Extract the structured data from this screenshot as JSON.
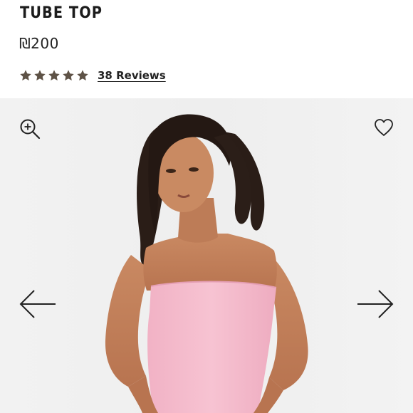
{
  "product": {
    "title": "TUBE TOP",
    "price": "₪200",
    "rating": 5,
    "rating_max": 5,
    "reviews_label": "38 Reviews"
  },
  "gallery": {
    "image_description": "Model with long dark hair wearing a pink strapless tube top against a light grey background",
    "icons": {
      "zoom": "zoom-in-icon",
      "wishlist": "heart-icon",
      "prev": "arrow-left-icon",
      "next": "arrow-right-icon"
    }
  },
  "colors": {
    "star": "#5e5246",
    "text": "#1c1c1c",
    "gallery_bg": "#f0f0f0",
    "top_pink": "#f4b8ca"
  }
}
